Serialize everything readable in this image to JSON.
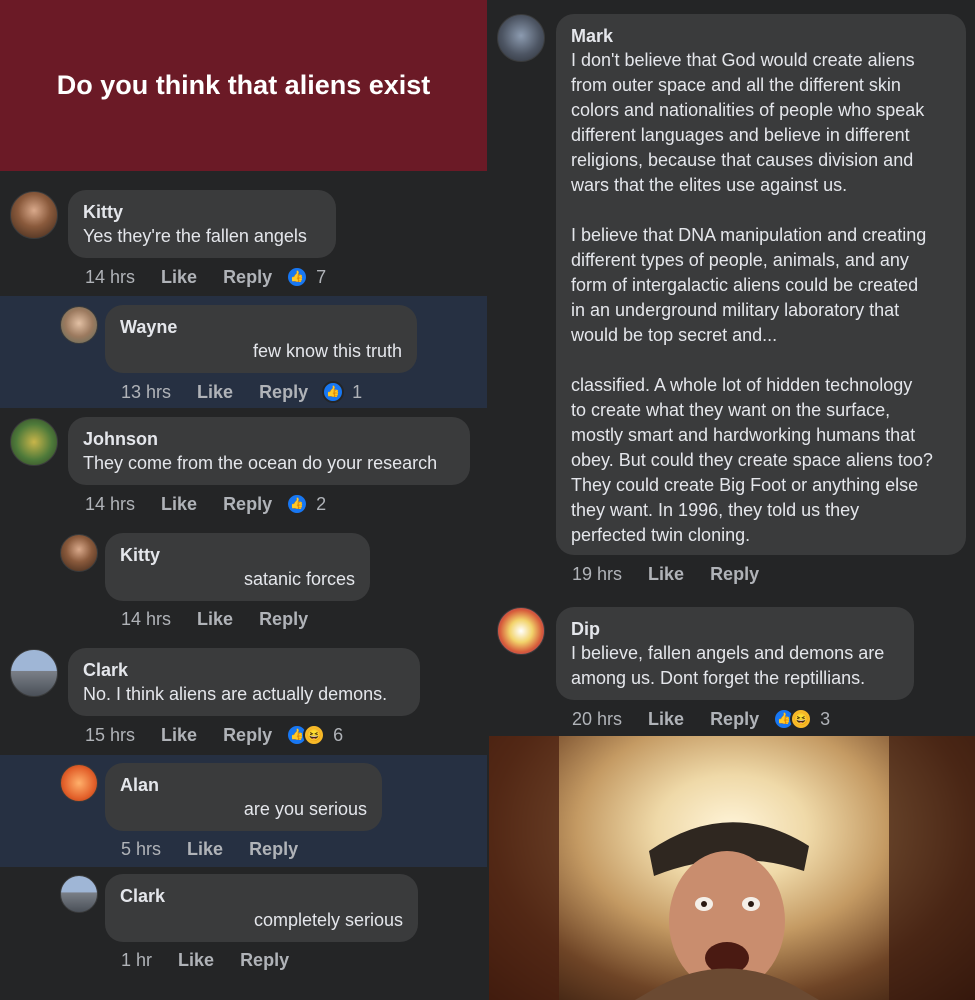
{
  "post": {
    "title": "Do you think that aliens exist"
  },
  "comments": [
    {
      "name": "Kitty",
      "text": "Yes they're the fallen angels",
      "time": "14 hrs",
      "like": "Like",
      "reply": "Reply",
      "reactions": [
        "like"
      ],
      "count": "7"
    },
    {
      "name": "Wayne",
      "text": "few know this truth",
      "time": "13 hrs",
      "like": "Like",
      "reply": "Reply",
      "reactions": [
        "like"
      ],
      "count": "1"
    },
    {
      "name": "Johnson",
      "text": "They come from the ocean do your research",
      "time": "14 hrs",
      "like": "Like",
      "reply": "Reply",
      "reactions": [
        "like"
      ],
      "count": "2"
    },
    {
      "name": "Kitty",
      "text": "satanic forces",
      "time": "14 hrs",
      "like": "Like",
      "reply": "Reply"
    },
    {
      "name": "Clark",
      "text": "No. I think aliens are actually demons.",
      "time": "15 hrs",
      "like": "Like",
      "reply": "Reply",
      "reactions": [
        "like",
        "haha"
      ],
      "count": "6"
    },
    {
      "name": "Alan",
      "text": "are you serious",
      "time": "5 hrs",
      "like": "Like",
      "reply": "Reply"
    },
    {
      "name": "Clark",
      "text": "completely serious",
      "time": "1 hr",
      "like": "Like",
      "reply": "Reply"
    },
    {
      "name": "Mark",
      "text": "I don't believe that God would create aliens\nfrom outer space and all the different skin\ncolors and nationalities of people who speak\ndifferent languages and believe in different\nreligions, because that causes division and\nwars that the elites use against us.\n\nI believe that DNA manipulation and creating\ndifferent types of people, animals, and any\nform of intergalactic aliens could be created\nin an underground military laboratory that\nwould be top secret and...\n\nclassified. A whole lot of hidden technology\nto create what they want on the surface,\nmostly smart and hardworking humans that\nobey. But could they create space aliens too?\nThey could create Big Foot or anything else\nthey want. In 1996, they told us they\nperfected twin cloning.",
      "time": "19 hrs",
      "like": "Like",
      "reply": "Reply"
    },
    {
      "name": "Dip",
      "text": "I believe, fallen angels and demons are\namong us. Dont forget the reptillians.",
      "time": "20 hrs",
      "like": "Like",
      "reply": "Reply",
      "reactions": [
        "like",
        "haha"
      ],
      "count": "3"
    }
  ],
  "colors": {
    "banner": "#6b1a26",
    "background": "#242526",
    "bubble": "#3a3b3c",
    "highlight": "#263042",
    "like": "#1877f2"
  }
}
